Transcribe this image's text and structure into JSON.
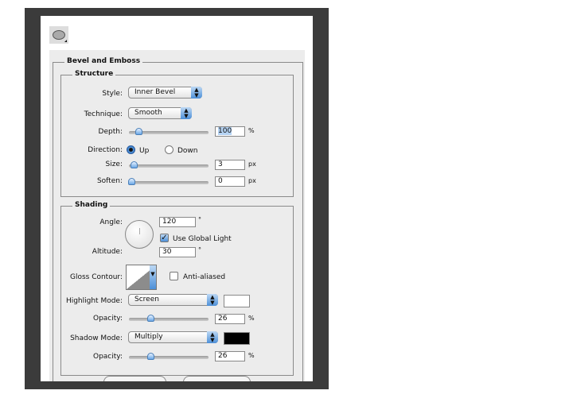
{
  "tool_icon": "ellipse-preset-icon",
  "bevel": {
    "title": "Bevel and Emboss",
    "structure": {
      "title": "Structure",
      "style_label": "Style:",
      "style_value": "Inner Bevel",
      "technique_label": "Technique:",
      "technique_value": "Smooth",
      "depth_label": "Depth:",
      "depth_value": "100",
      "depth_unit": "%",
      "depth_slider": 0.1,
      "direction_label": "Direction:",
      "up": "Up",
      "down": "Down",
      "direction_selected": "Up",
      "size_label": "Size:",
      "size_value": "3",
      "size_unit": "px",
      "size_slider": 0.03,
      "soften_label": "Soften:",
      "soften_value": "0",
      "soften_unit": "px",
      "soften_slider": 0
    },
    "shading": {
      "title": "Shading",
      "angle_label": "Angle:",
      "angle_value": "120",
      "angle_unit": "°",
      "global_light_label": "Use Global Light",
      "global_light_checked": true,
      "altitude_label": "Altitude:",
      "altitude_value": "30",
      "altitude_unit": "°",
      "gloss_label": "Gloss Contour:",
      "anti_aliased_label": "Anti-aliased",
      "anti_aliased_checked": false,
      "highlight_label": "Highlight Mode:",
      "highlight_value": "Screen",
      "highlight_color": "#ffffff",
      "opacity_label": "Opacity:",
      "highlight_opacity": "26",
      "opacity_unit": "%",
      "highlight_slider": 0.26,
      "shadow_label": "Shadow Mode:",
      "shadow_value": "Multiply",
      "shadow_color": "#000000",
      "shadow_opacity": "26",
      "shadow_slider": 0.26
    }
  }
}
